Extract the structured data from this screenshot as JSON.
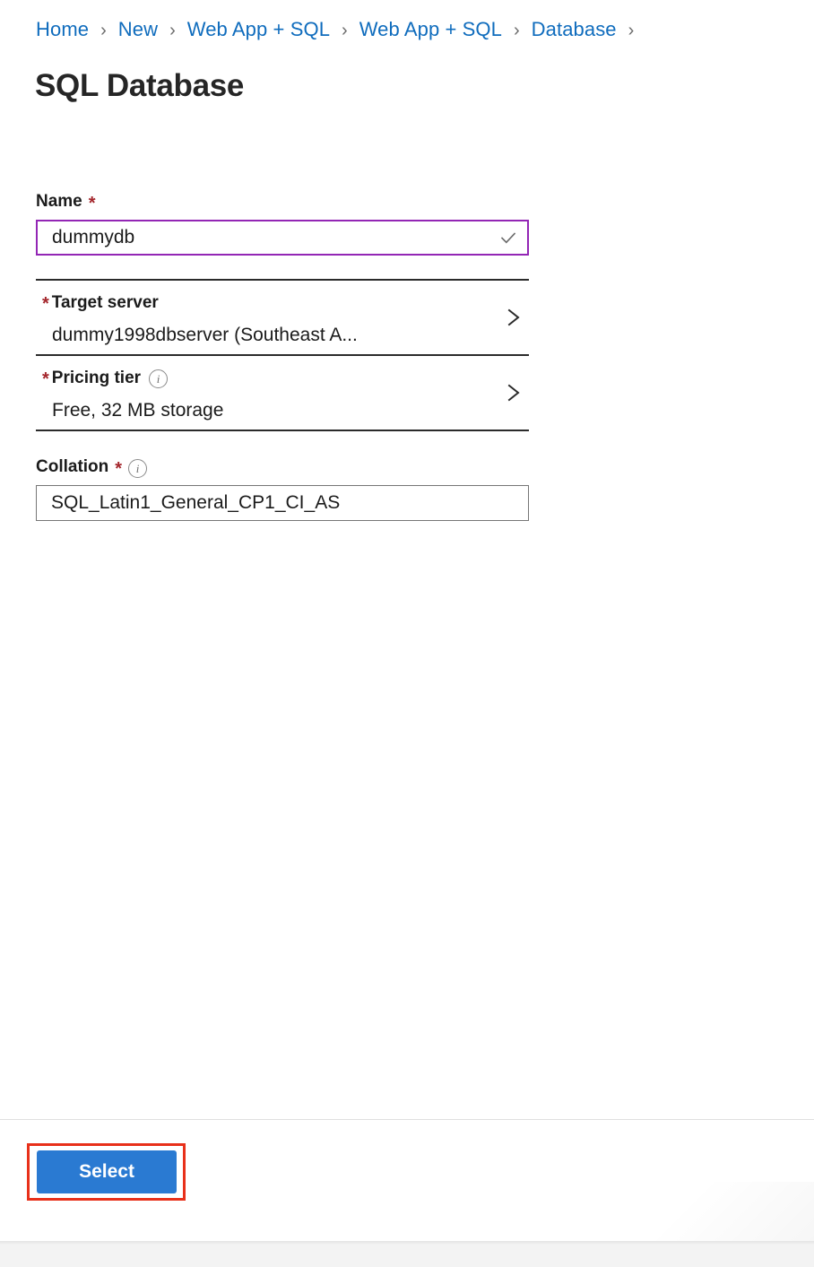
{
  "breadcrumb": {
    "separator": "›",
    "items": [
      {
        "label": "Home"
      },
      {
        "label": "New"
      },
      {
        "label": "Web App + SQL"
      },
      {
        "label": "Web App + SQL"
      },
      {
        "label": "Database"
      }
    ]
  },
  "page": {
    "title": "SQL Database"
  },
  "form": {
    "name": {
      "label": "Name",
      "required_marker": "*",
      "value": "dummydb",
      "validation_icon": "checkmark-icon"
    },
    "target_server": {
      "required_marker": "*",
      "label": "Target server",
      "value": "dummy1998dbserver (Southeast A...",
      "chevron_icon": "chevron-right-icon"
    },
    "pricing_tier": {
      "required_marker": "*",
      "label": "Pricing tier",
      "info_icon": "info-icon",
      "value": "Free, 32 MB storage",
      "chevron_icon": "chevron-right-icon"
    },
    "collation": {
      "label": "Collation",
      "required_marker": "*",
      "info_icon": "info-icon",
      "value": "SQL_Latin1_General_CP1_CI_AS"
    }
  },
  "footer": {
    "select_label": "Select"
  },
  "colors": {
    "link": "#0f6cbd",
    "required": "#a4262c",
    "focus_border": "#9326b5",
    "primary_button": "#2a7ad2",
    "highlight_box": "#e8301a",
    "separator": "#2b2b2b",
    "input_border": "#767676"
  }
}
